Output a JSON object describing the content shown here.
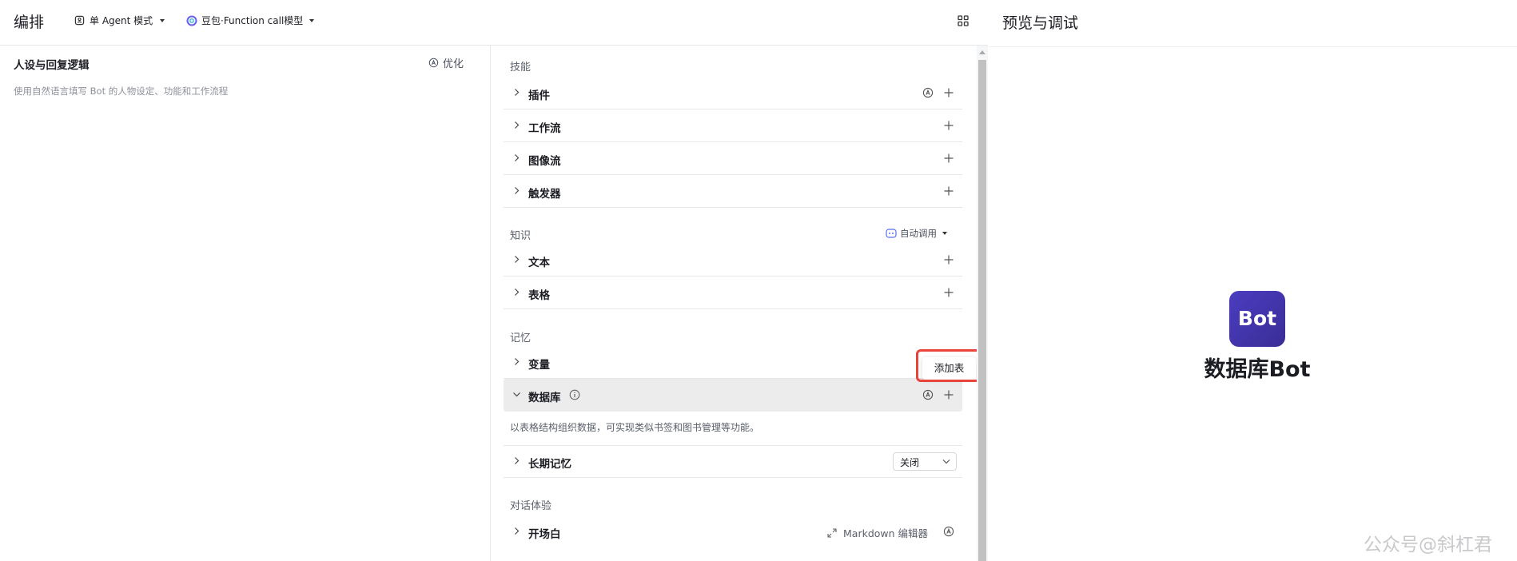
{
  "header": {
    "title": "编排",
    "mode": "单 Agent 模式",
    "model": "豆包·Function call模型"
  },
  "prompt": {
    "title": "人设与回复逻辑",
    "optimize": "优化",
    "placeholder": "使用自然语言填写 Bot 的人物设定、功能和工作流程"
  },
  "skills": {
    "title": "技能",
    "items": [
      "插件",
      "工作流",
      "图像流",
      "触发器"
    ]
  },
  "knowledge": {
    "title": "知识",
    "auto_call": "自动调用",
    "items": [
      "文本",
      "表格"
    ]
  },
  "memory": {
    "title": "记忆",
    "variable": "变量",
    "database": "数据库",
    "database_desc": "以表格结构组织数据，可实现类似书签和图书管理等功能。",
    "long_term": "长期记忆",
    "long_term_value": "关闭",
    "tooltip": "添加表"
  },
  "dialog": {
    "title": "对话体验",
    "opening": "开场白",
    "md_editor": "Markdown 编辑器"
  },
  "preview": {
    "title": "预览与调试",
    "avatar_text": "Bot",
    "bot_name": "数据库Bot"
  },
  "watermark": "公众号@斜杠君",
  "colors": {
    "highlight": "#e8443a",
    "avatar": "#3f33a8",
    "model_icon": "#6c5cf0"
  }
}
